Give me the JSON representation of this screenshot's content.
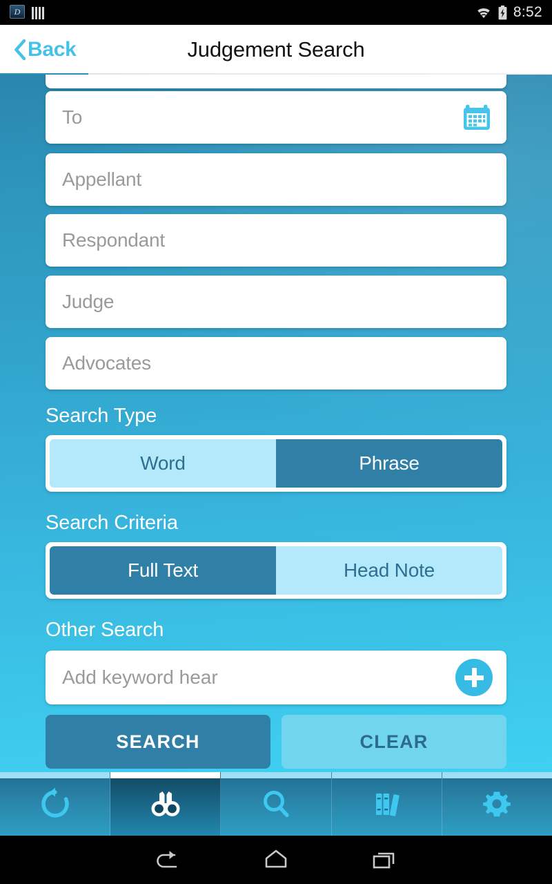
{
  "status_bar": {
    "time": "8:52",
    "icons": [
      "app-book-icon",
      "barcode-icon",
      "wifi-icon",
      "battery-charging-icon"
    ]
  },
  "app_bar": {
    "back_label": "Back",
    "title": "Judgement Search"
  },
  "form": {
    "fields": [
      {
        "name": "to-field",
        "placeholder": "To",
        "value": "",
        "has_calendar": true
      },
      {
        "name": "appellant-field",
        "placeholder": "Appellant",
        "value": "",
        "has_calendar": false
      },
      {
        "name": "respondant-field",
        "placeholder": "Respondant",
        "value": "",
        "has_calendar": false
      },
      {
        "name": "judge-field",
        "placeholder": "Judge",
        "value": "",
        "has_calendar": false
      },
      {
        "name": "advocates-field",
        "placeholder": "Advocates",
        "value": "",
        "has_calendar": false
      }
    ],
    "search_type": {
      "label": "Search Type",
      "options": [
        "Word",
        "Phrase"
      ],
      "selected": "Phrase"
    },
    "search_criteria": {
      "label": "Search Criteria",
      "options": [
        "Full Text",
        "Head Note"
      ],
      "selected": "Full Text"
    },
    "other_search": {
      "label": "Other Search",
      "keyword_placeholder": "Add keyword hear",
      "keyword_value": "",
      "add_button": "add-keyword-icon"
    },
    "actions": {
      "search_label": "SEARCH",
      "clear_label": "CLEAR"
    }
  },
  "tab_bar": {
    "items": [
      {
        "name": "tab-refresh",
        "icon": "refresh-icon",
        "active": false
      },
      {
        "name": "tab-search-view",
        "icon": "binoculars-icon",
        "active": true
      },
      {
        "name": "tab-search",
        "icon": "magnifier-icon",
        "active": false
      },
      {
        "name": "tab-library",
        "icon": "books-icon",
        "active": false
      },
      {
        "name": "tab-settings",
        "icon": "gear-icon",
        "active": false
      }
    ]
  },
  "system_nav": {
    "buttons": [
      "back-nav-icon",
      "home-nav-icon",
      "recents-nav-icon"
    ]
  },
  "colors": {
    "accent": "#45c2e8",
    "selected_segment": "#2f7fa6",
    "unselected_segment": "#b3e9fa",
    "bg_top": "#2a86ad",
    "bg_bottom": "#3fd0f2"
  }
}
